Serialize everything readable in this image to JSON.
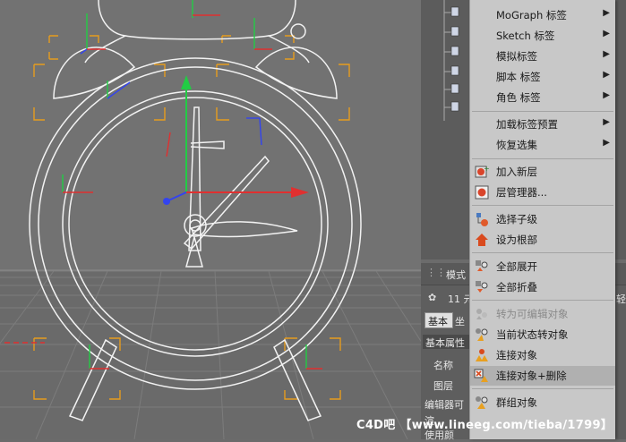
{
  "menu": {
    "items": [
      {
        "label": "MoGraph 标签",
        "submenu": true,
        "icon": ""
      },
      {
        "label": "Sketch 标签",
        "submenu": true,
        "icon": ""
      },
      {
        "label": "模拟标签",
        "submenu": true,
        "icon": ""
      },
      {
        "label": "脚本 标签",
        "submenu": true,
        "icon": ""
      },
      {
        "label": "角色 标签",
        "submenu": true,
        "icon": ""
      },
      {
        "label": "加载标签预置",
        "submenu": true,
        "icon": ""
      },
      {
        "label": "恢复选集",
        "submenu": true,
        "icon": ""
      },
      {
        "label": "加入新层",
        "submenu": false,
        "icon": "layer-add-icon"
      },
      {
        "label": "层管理器...",
        "submenu": false,
        "icon": "layer-manager-icon"
      },
      {
        "label": "选择子级",
        "submenu": false,
        "icon": "select-children-icon"
      },
      {
        "label": "设为根部",
        "submenu": false,
        "icon": "set-root-icon"
      },
      {
        "label": "全部展开",
        "submenu": false,
        "icon": "expand-all-icon"
      },
      {
        "label": "全部折叠",
        "submenu": false,
        "icon": "collapse-all-icon"
      },
      {
        "label": "转为可编辑对象",
        "submenu": false,
        "icon": "make-editable-icon",
        "disabled": true
      },
      {
        "label": "当前状态转对象",
        "submenu": false,
        "icon": "current-state-icon"
      },
      {
        "label": "连接对象",
        "submenu": false,
        "icon": "connect-objects-icon"
      },
      {
        "label": "连接对象+删除",
        "submenu": false,
        "icon": "connect-delete-icon",
        "highlighted": true
      },
      {
        "label": "群组对象",
        "submenu": false,
        "icon": "group-objects-icon"
      }
    ]
  },
  "attributes": {
    "mode_label": "模式",
    "count_label": "11 元",
    "right_edge_label": "轻",
    "tab_basic": "基本",
    "tab_coord": "坐",
    "section_title": "基本属性",
    "name_label": "名称",
    "layer_label": "图层",
    "editor_label": "编辑器可",
    "render_label": "渲",
    "use_label": "使用颜"
  },
  "watermark": "C4D吧 【www.lineeg.com/tieba/1799】",
  "colors": {
    "menu_bg": "#c8c8c8",
    "highlight": "#b0b0b0",
    "axis_x": "#e03030",
    "axis_y": "#22cc44",
    "axis_z": "#3344ee",
    "bbox": "#e69c1e"
  }
}
